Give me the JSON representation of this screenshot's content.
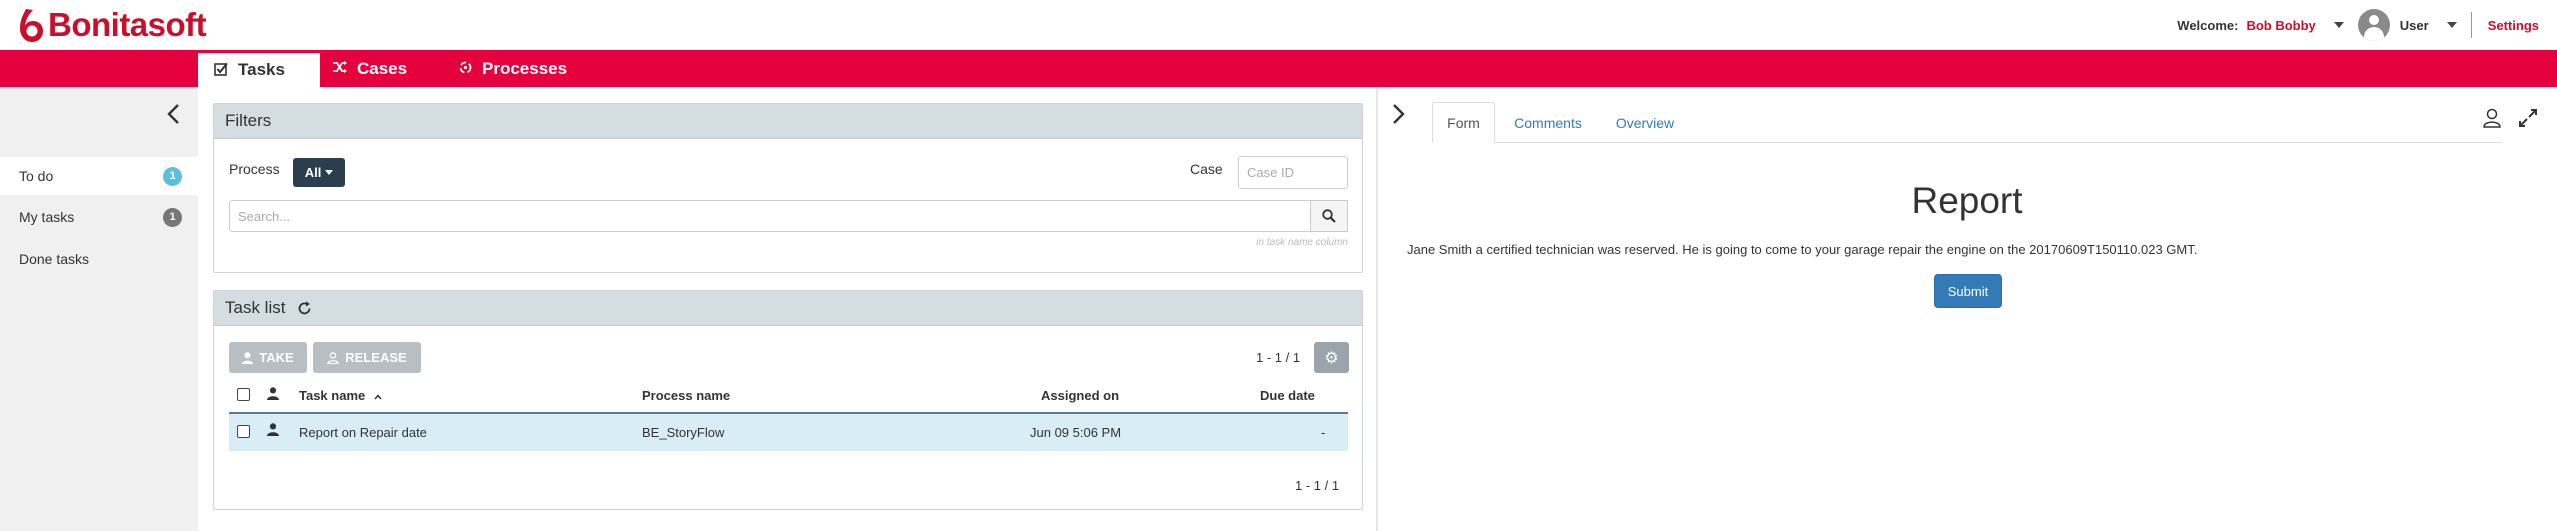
{
  "app": {
    "brand": "Bonitasoft",
    "brand_color": "#c8102e",
    "nav_color": "#e5003e"
  },
  "user": {
    "welcome_label": "Welcome:",
    "name": "Bob Bobby",
    "role": "User",
    "settings_label": "Settings"
  },
  "nav": {
    "tabs": [
      {
        "label": "Tasks",
        "icon": "check-square-icon",
        "active": true
      },
      {
        "label": "Cases",
        "icon": "shuffle-icon",
        "active": false
      },
      {
        "label": "Processes",
        "icon": "process-icon",
        "active": false
      }
    ]
  },
  "sidebar": {
    "items": [
      {
        "label": "To do",
        "count": "1",
        "badge_color": "#5bc0de",
        "active": true
      },
      {
        "label": "My tasks",
        "count": "1",
        "badge_color": "#777777",
        "active": false
      },
      {
        "label": "Done tasks",
        "count": null,
        "active": false
      }
    ]
  },
  "filters": {
    "title": "Filters",
    "process_label": "Process",
    "process_value": "All",
    "case_label": "Case",
    "case_placeholder": "Case ID",
    "search_placeholder": "Search...",
    "search_hint": "in task name column"
  },
  "tasklist": {
    "title": "Task list",
    "take_label": "TAKE",
    "release_label": "RELEASE",
    "pagination_top": "1 - 1 / 1",
    "pagination_bottom": "1 - 1 / 1",
    "columns": {
      "task_name": "Task name",
      "process_name": "Process name",
      "assigned_on": "Assigned on",
      "due_date": "Due date"
    },
    "rows": [
      {
        "task_name": "Report on Repair date",
        "process_name": "BE_StoryFlow",
        "assigned_on": "Jun 09 5:06 PM",
        "due_date": "-"
      }
    ]
  },
  "detail": {
    "tabs": [
      {
        "label": "Form",
        "active": true
      },
      {
        "label": "Comments",
        "active": false
      },
      {
        "label": "Overview",
        "active": false
      }
    ],
    "form_title": "Report",
    "form_text": "Jane Smith a certified technician was reserved. He is going to come to your garage repair the engine on the 20170609T150110.023 GMT.",
    "submit_label": "Submit"
  }
}
